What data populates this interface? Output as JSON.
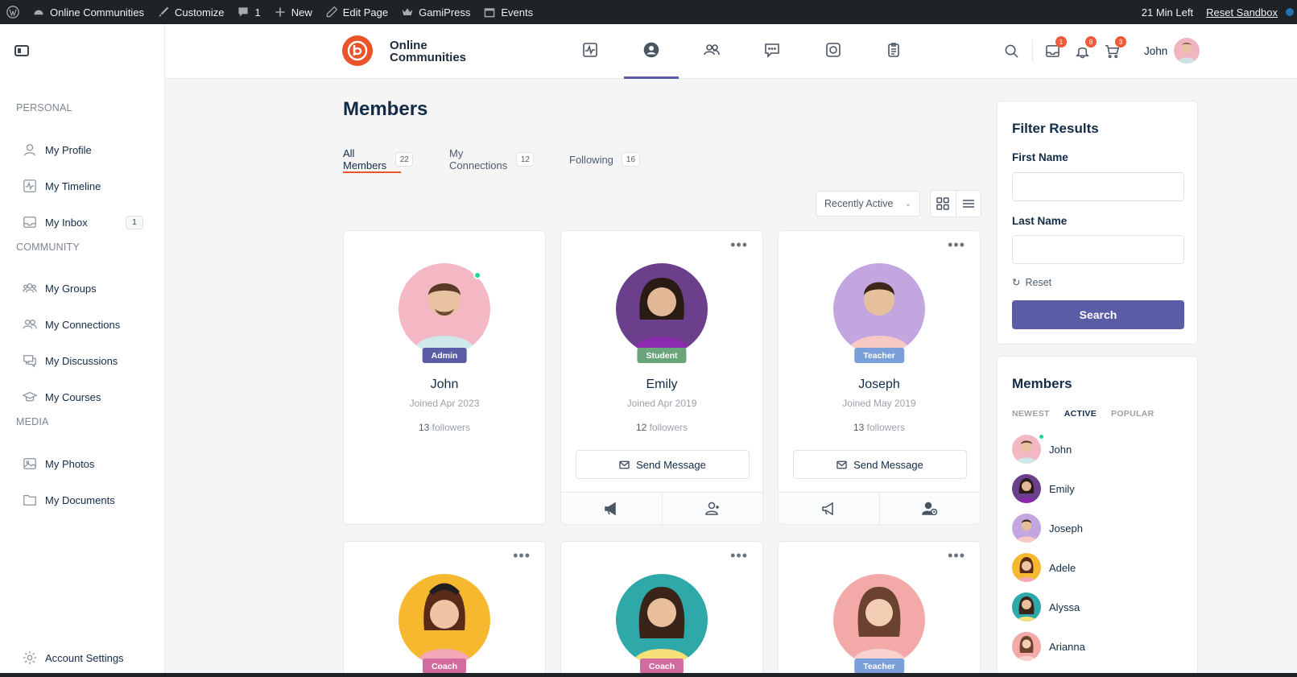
{
  "admin_bar": {
    "site_name": "Online Communities",
    "customize": "Customize",
    "comments_count": "1",
    "new": "New",
    "edit_page": "Edit Page",
    "gamipress": "GamiPress",
    "events": "Events",
    "time_left": "21 Min Left",
    "reset_sandbox": "Reset Sandbox"
  },
  "sidebar": {
    "personal_heading": "PERSONAL",
    "community_heading": "COMMUNITY",
    "media_heading": "MEDIA",
    "items": [
      {
        "label": "My Profile",
        "icon": "user-icon"
      },
      {
        "label": "My Timeline",
        "icon": "activity-icon"
      },
      {
        "label": "My Inbox",
        "icon": "inbox-icon",
        "badge": "1"
      },
      {
        "label": "My Groups",
        "icon": "groups-icon"
      },
      {
        "label": "My Connections",
        "icon": "connections-icon"
      },
      {
        "label": "My Discussions",
        "icon": "discussions-icon"
      },
      {
        "label": "My Courses",
        "icon": "courses-icon"
      },
      {
        "label": "My Photos",
        "icon": "photos-icon"
      },
      {
        "label": "My Documents",
        "icon": "documents-icon"
      }
    ],
    "account_settings": "Account Settings"
  },
  "header": {
    "logo_line1": "Online",
    "logo_line2": "Communities",
    "user_name": "John",
    "badges": {
      "messages": "1",
      "notifications": "8",
      "cart": "3"
    }
  },
  "main": {
    "title": "Members",
    "tabs": [
      {
        "label": "All Members",
        "count": "22"
      },
      {
        "label": "My Connections",
        "count": "12"
      },
      {
        "label": "Following",
        "count": "16"
      }
    ],
    "sort_value": "Recently Active",
    "members": [
      {
        "name": "John",
        "role": "Admin",
        "joined": "Joined Apr 2023",
        "followers_num": "13",
        "followers_word": "followers",
        "role_color": "#5a5ca5",
        "bg": "#f3b8c4"
      },
      {
        "name": "Emily",
        "role": "Student",
        "joined": "Joined Apr 2019",
        "followers_num": "12",
        "followers_word": "followers",
        "role_color": "#6aa57a",
        "bg": "#6b3f8c"
      },
      {
        "name": "Joseph",
        "role": "Teacher",
        "joined": "Joined May 2019",
        "followers_num": "13",
        "followers_word": "followers",
        "role_color": "#7b9fd8",
        "bg": "#c3a6e0"
      },
      {
        "name": "",
        "role": "Coach",
        "role_color": "#d26c9e",
        "bg": "#f5b82e"
      },
      {
        "name": "",
        "role": "Coach",
        "role_color": "#d26c9e",
        "bg": "#2ea8a8"
      },
      {
        "name": "",
        "role": "Teacher",
        "role_color": "#7b9fd8",
        "bg": "#f4a9a9"
      }
    ],
    "send_message": "Send Message"
  },
  "filter": {
    "title": "Filter Results",
    "first_name_label": "First Name",
    "last_name_label": "Last Name",
    "reset": "Reset",
    "search": "Search"
  },
  "members_widget": {
    "title": "Members",
    "tabs": [
      "NEWEST",
      "ACTIVE",
      "POPULAR"
    ],
    "list": [
      "John",
      "Emily",
      "Joseph",
      "Adele",
      "Alyssa",
      "Arianna"
    ]
  },
  "colors": {
    "accent": "#5a5ca5",
    "brand": "#e9542a",
    "online": "#1cd991"
  }
}
